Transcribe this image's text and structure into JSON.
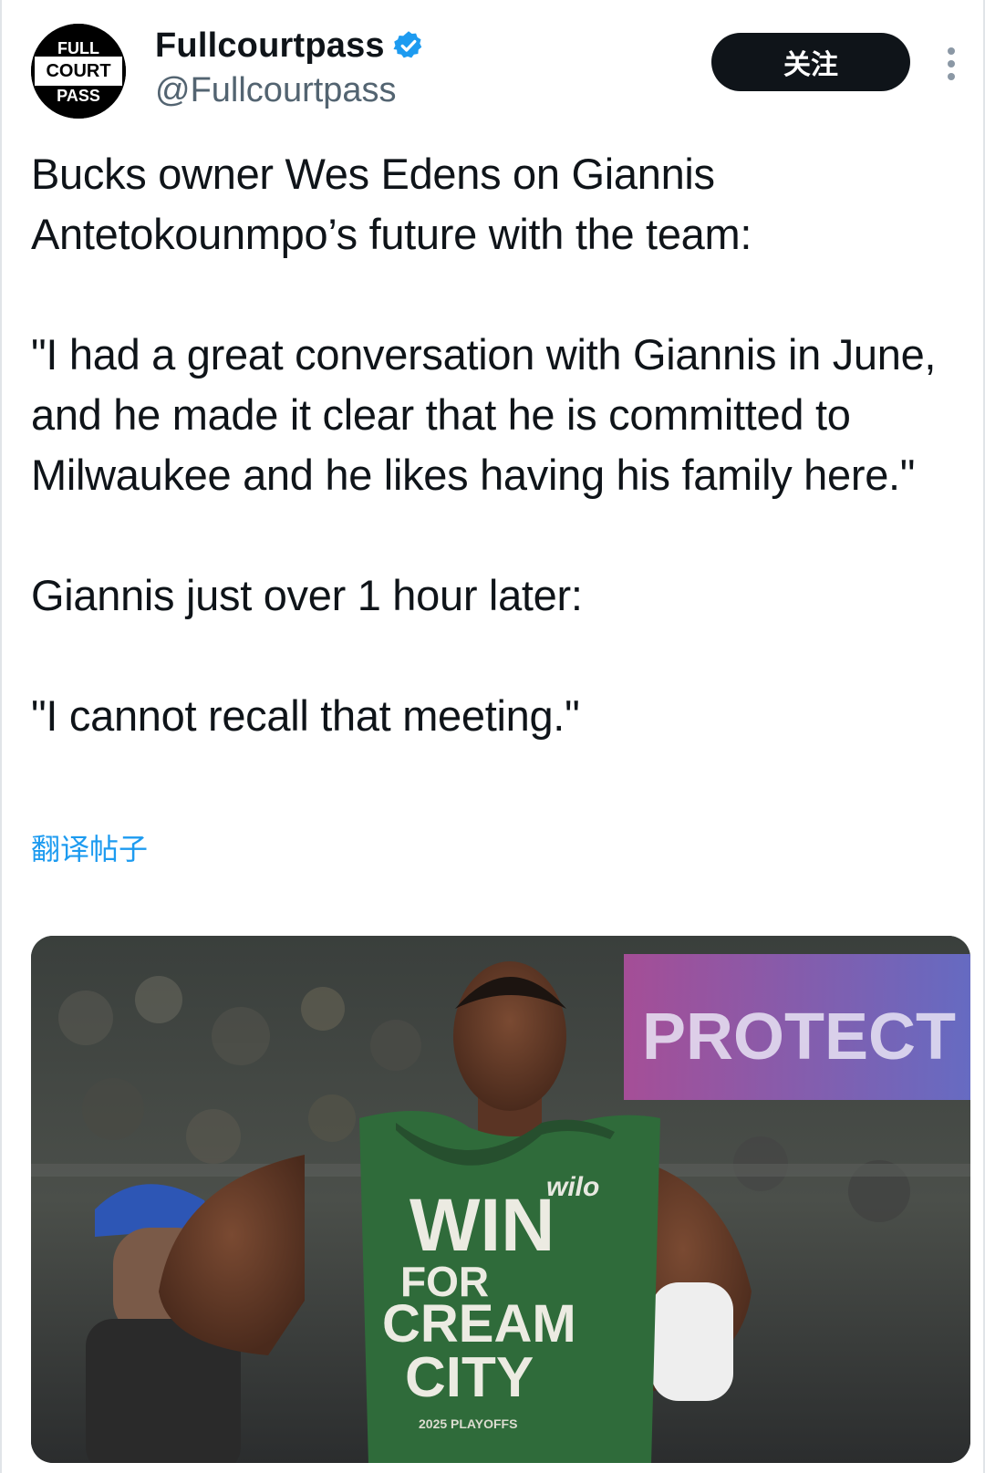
{
  "account": {
    "display_name": "Fullcourtpass",
    "handle": "@Fullcourtpass",
    "avatar_logo_lines": [
      "FULL",
      "COURT",
      "PASS"
    ],
    "verified": true
  },
  "actions": {
    "follow_label": "关注",
    "more_icon": "more-vertical-icon"
  },
  "tweet": {
    "paragraphs": [
      "Bucks owner Wes Edens on Giannis Antetokounmpo’s future with the team:",
      "\"I had a great conversation with Giannis in June, and he made it clear that he is committed to Milwaukee and he likes having his family here.\"",
      "Giannis just over 1 hour later:",
      "\"I cannot recall that meeting.\""
    ],
    "translate_label": "翻译帖子"
  },
  "media": {
    "jersey_lines": [
      "WIN",
      "FOR",
      "CREAM",
      "CITY"
    ],
    "jersey_sponsor": "wilo",
    "jersey_small": "2025 PLAYOFFS",
    "background_sign": "PROTECT"
  },
  "colors": {
    "text": "#0f1419",
    "secondary": "#536471",
    "link": "#1d9bf0",
    "verified": "#1d9bf0",
    "button_bg": "#0f1419",
    "jersey_green": "#2f6b3a"
  }
}
